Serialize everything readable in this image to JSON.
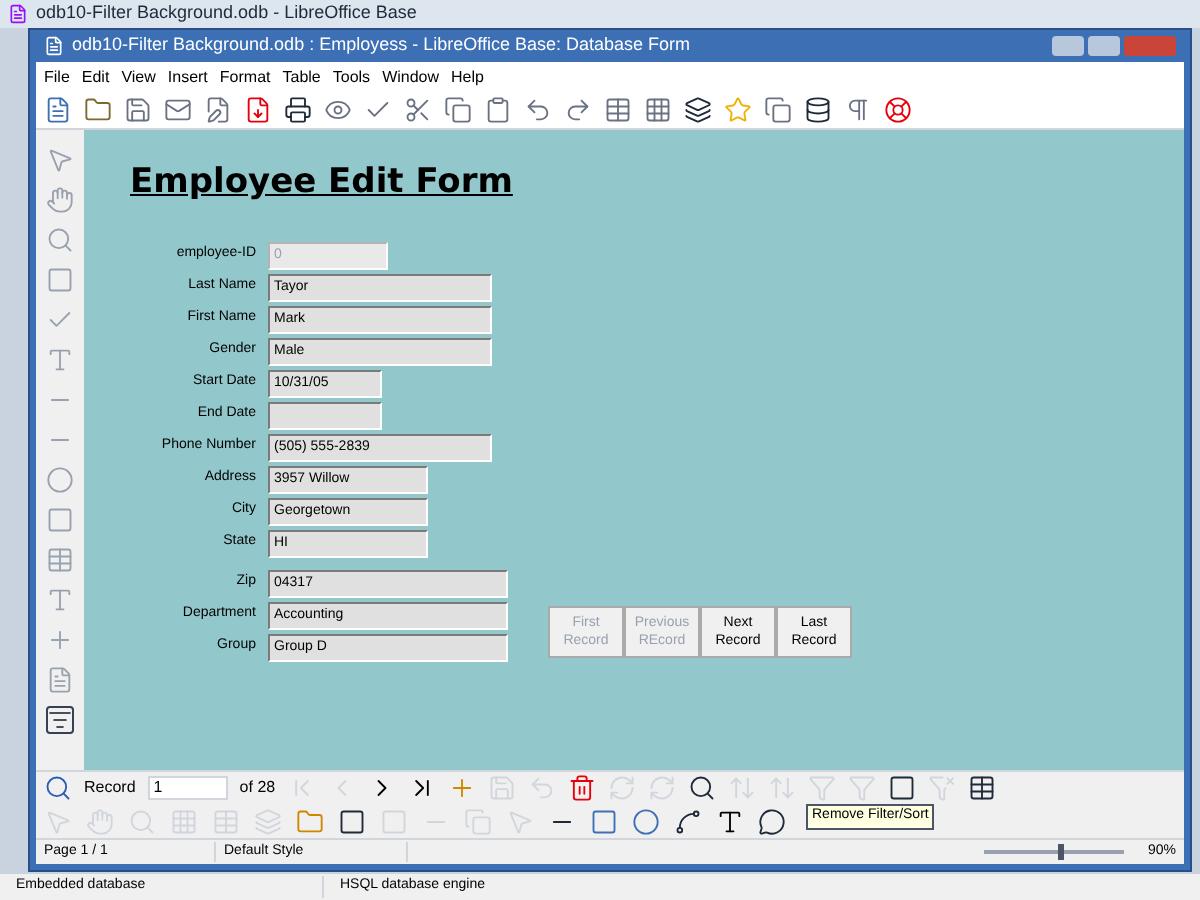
{
  "outer_window": {
    "title": "odb10-Filter Background.odb - LibreOffice Base"
  },
  "window": {
    "title": "odb10-Filter Background.odb : Employess - LibreOffice Base: Database Form"
  },
  "menu": [
    "File",
    "Edit",
    "View",
    "Insert",
    "Format",
    "Table",
    "Tools",
    "Window",
    "Help"
  ],
  "form": {
    "title": "Employee Edit Form",
    "fields": [
      {
        "label": "employee-ID",
        "value": "0",
        "disabled": true
      },
      {
        "label": "Last Name",
        "value": "Tayor",
        "disabled": false
      },
      {
        "label": "First Name",
        "value": "Mark",
        "disabled": false
      },
      {
        "label": "Gender",
        "value": "Male",
        "disabled": false
      },
      {
        "label": "Start Date",
        "value": "10/31/05",
        "disabled": false
      },
      {
        "label": "End Date",
        "disabled": false
      },
      {
        "label": "Phone Number",
        "value": "(505) 555-2839",
        "disabled": false
      },
      {
        "label": "Address",
        "value": "3957 Willow",
        "disabled": false
      },
      {
        "label": "City",
        "value": "Georgetown",
        "disabled": false
      },
      {
        "label": "State",
        "value": "HI",
        "disabled": false
      },
      {
        "label": "Zip",
        "value": "04317",
        "disabled": false
      },
      {
        "label": "Department",
        "value": "Accounting",
        "disabled": false
      },
      {
        "label": "Group",
        "value": "Group D",
        "disabled": false
      }
    ],
    "buttons": [
      {
        "label": "First Record",
        "disabled": true
      },
      {
        "label": "Previous REcord",
        "disabled": true
      },
      {
        "label": "Next Record",
        "disabled": false
      },
      {
        "label": "Last Record",
        "disabled": false
      }
    ]
  },
  "navigation": {
    "record_label": "Record",
    "record_value": "1",
    "total": "of 28"
  },
  "tooltip": "Remove Filter/Sort",
  "status_bar": [
    "Page 1 / 1",
    "Default Style",
    "90%"
  ],
  "zoom": {
    "level": 0.55
  },
  "outer_status_bar": [
    "Embedded database",
    "HSQL database engine"
  ]
}
